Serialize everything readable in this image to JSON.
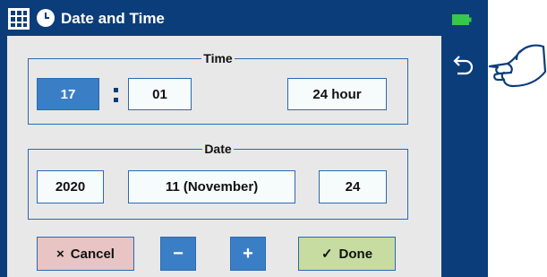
{
  "window": {
    "title": "Date and Time"
  },
  "time": {
    "legend": "Time",
    "hour": "17",
    "separator": ":",
    "minute": "01",
    "format": "24 hour"
  },
  "date": {
    "legend": "Date",
    "year": "2020",
    "month": "11 (November)",
    "day": "24"
  },
  "buttons": {
    "cancel": {
      "glyph": "×",
      "label": "Cancel"
    },
    "minus": {
      "glyph": "−"
    },
    "plus": {
      "glyph": "+"
    },
    "done": {
      "glyph": "✓",
      "label": "Done"
    }
  },
  "icons": [
    "grid-icon",
    "clock-icon",
    "battery-icon",
    "back-icon",
    "pointing-hand-icon"
  ],
  "colors": {
    "titlebar": "#0b3d7a",
    "panel": "#e8e8e8",
    "selected": "#3a7fc6",
    "cancel": "#e8c4c4",
    "done": "#c6dca0",
    "battery": "#37c84b"
  }
}
